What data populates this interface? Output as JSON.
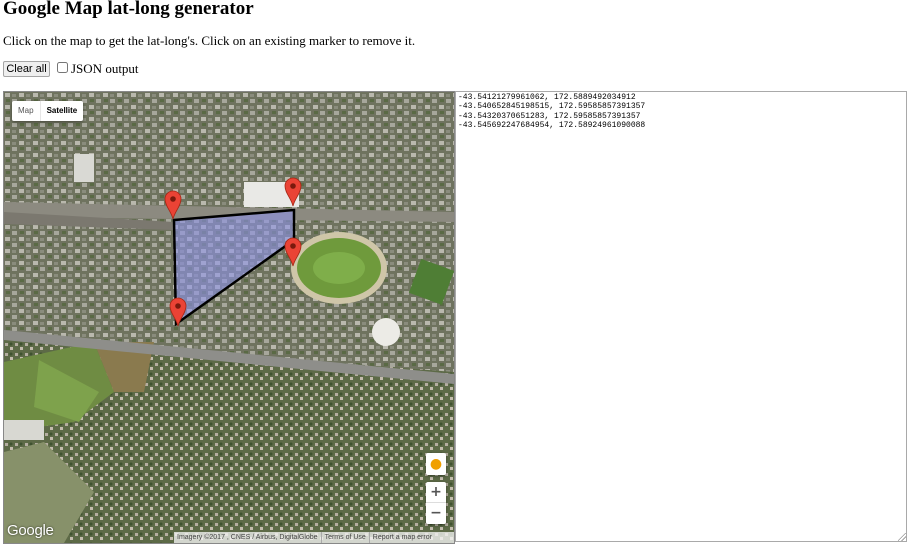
{
  "page": {
    "title": "Google Map lat-long generator",
    "instructions": "Click on the map to get the lat-long's. Click on an existing marker to remove it."
  },
  "controls": {
    "clear_label": "Clear all",
    "json_label": "JSON output",
    "json_checked": false
  },
  "map": {
    "type_buttons": [
      "Map",
      "Satellite"
    ],
    "selected_type": "Satellite",
    "logo": "Google",
    "attribution": [
      "Imagery ©2017 , CNES / Airbus, DigitalGlobe",
      "Terms of Use",
      "Report a map error"
    ],
    "zoom_in": "+",
    "zoom_out": "−",
    "marker_color": "#ea4335",
    "polygon_fill": "#8e92e8",
    "markers": [
      "marker-1",
      "marker-2",
      "marker-3",
      "marker-4"
    ]
  },
  "output": {
    "text": "-43.54121279961062, 172.5889492034912\n-43.540652845198515, 172.59585857391357\n-43.54320370651283, 172.59585857391357\n-43.545692247684954, 172.58924961090088"
  }
}
